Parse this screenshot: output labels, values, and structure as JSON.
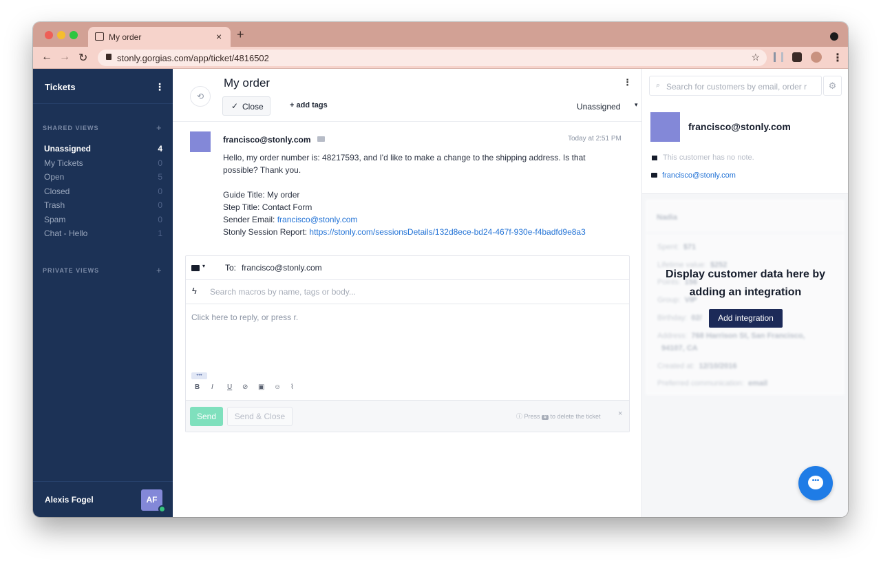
{
  "browser": {
    "tab_title": "My order",
    "tab_close": "×",
    "new_tab": "+",
    "url": "stonly.gorgias.com/app/ticket/4816502",
    "back": "←",
    "forward": "→",
    "reload": "↻",
    "star": "☆",
    "menu": "⋮",
    "colors": {
      "chrome": "#d2a195",
      "tab": "#f6d3cb"
    }
  },
  "sidebar": {
    "title": "Tickets",
    "menu_glyph": "⋮",
    "shared_header": "SHARED VIEWS",
    "private_header": "PRIVATE VIEWS",
    "add_glyph": "+",
    "items": [
      {
        "label": "Unassigned",
        "count": "4",
        "active": true
      },
      {
        "label": "My Tickets",
        "count": "0"
      },
      {
        "label": "Open",
        "count": "5"
      },
      {
        "label": "Closed",
        "count": "0"
      },
      {
        "label": "Trash",
        "count": "0"
      },
      {
        "label": "Spam",
        "count": "0"
      },
      {
        "label": "Chat - Hello",
        "count": "1"
      }
    ],
    "user_name": "Alexis Fogel",
    "user_initials": "AF",
    "colors": {
      "bg": "#1c3256",
      "avatar": "#8388d8",
      "online": "#36c37e"
    }
  },
  "ticket": {
    "title": "My order",
    "history_glyph": "⟲",
    "menu_glyph": "⋮",
    "close_check": "✓",
    "close_label": "Close",
    "add_tags": "+ add tags",
    "assignee": "Unassigned",
    "assignee_caret": "▾",
    "message": {
      "from": "francisco@stonly.com",
      "time": "Today at 2:51 PM",
      "line1": "Hello, my order number is: 48217593, and I'd like to make a change to the shipping address. Is that",
      "line2": "possible? Thank you.",
      "guide_title": "Guide Title: My order",
      "step_title": "Step Title: Contact Form",
      "sender_label": "Sender Email: ",
      "sender_email": "francisco@stonly.com",
      "report_label": "Stonly Session Report: ",
      "report_link": "https://stonly.com/sessionsDetails/132d8ece-bd24-467f-930e-f4badfd9e8a3"
    }
  },
  "composer": {
    "env_caret": "▾",
    "to_label": "To:",
    "to_value": "francisco@stonly.com",
    "bolt_glyph": "ϟ",
    "macro_placeholder": "Search macros by name, tags or body...",
    "reply_placeholder": "Click here to reply, or press r.",
    "more_glyph": "•••",
    "format": {
      "bold": "B",
      "italic": "I",
      "underline": "U",
      "link": "⊘",
      "image": "▣",
      "emoji": "☺",
      "attach": "⌇"
    },
    "send_label": "Send",
    "send_close_label": "Send & Close",
    "hint_prefix": "Press",
    "hint_key": "#",
    "hint_suffix": "to delete the ticket",
    "hint_close": "×",
    "colors": {
      "send": "#7fe0bd"
    }
  },
  "customer": {
    "search_glyph": "⌕",
    "search_placeholder": "Search for customers by email, order r",
    "gear_glyph": "⚙",
    "email_name": "francisco@stonly.com",
    "note_placeholder": "This customer has no note.",
    "email": "francisco@stonly.com",
    "blurred": {
      "name": "Nadia",
      "rows": [
        {
          "label": "Spent:",
          "value": "$71"
        },
        {
          "label": "Lifetime value:",
          "value": "$252"
        },
        {
          "label": "Points:",
          "value": "156"
        },
        {
          "label": "Group:",
          "value": "VIP"
        },
        {
          "label": "Birthday:",
          "value": "02/"
        },
        {
          "label": "Address:",
          "value": "768 Harrison St, San Francisco,"
        },
        {
          "label": "",
          "value": "94107, CA"
        },
        {
          "label": "Created at:",
          "value": "12/10/2016"
        },
        {
          "label": "Preferred communication:",
          "value": "email"
        }
      ]
    },
    "integration_title_1": "Display customer data here by",
    "integration_title_2": "adding an integration",
    "integration_button": "Add integration",
    "chat_glyph": "•••",
    "colors": {
      "integration_btn": "#1c2a58",
      "chat": "#1f7ce6"
    }
  }
}
